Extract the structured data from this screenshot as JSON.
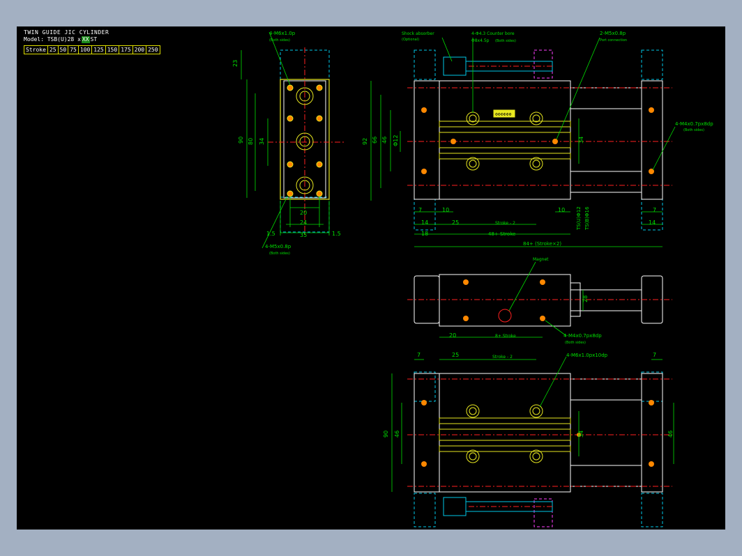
{
  "colors": {
    "background": "#000000",
    "outline": "#ffffff",
    "body": "#e8e820",
    "hidden": "#00c8e8",
    "dimension": "#00e000",
    "center": "#ff2020",
    "hole": "#ff8800",
    "option": "#ff40ff"
  },
  "title": {
    "name": "TWIN GUIDE JIC CYLINDER",
    "model_prefix": "Model: TSB(U)28 x",
    "model_size": "XX",
    "model_suffix": "ST"
  },
  "stroke_table": {
    "label": "Stroke",
    "values": [
      "25",
      "50",
      "75",
      "100",
      "125",
      "150",
      "175",
      "200",
      "250"
    ]
  },
  "callouts": {
    "side_top": "4-M6x1.0p",
    "both_sides": "(Both sides)",
    "side_bottom": "4-M5x0.8p",
    "shock_absorber": "Shock absorber",
    "optional": "(Optional)",
    "counter_bore": "4-Φ4.3 Counter bore",
    "counter_bore_sub": "Φ8x4.5p",
    "port": "2-M5x0.8p",
    "port_sub": "Port connection",
    "right_tap": "4-M4x0.7px8dp",
    "magnet": "Magnet",
    "mid_tap": "4-M4x0.7px8dp",
    "bottom_tap": "4-M6x1.0px10dp",
    "plate_label": "ΦΦΦΦΦΦ"
  },
  "dims": {
    "d23": "23",
    "d90": "90",
    "d80": "80",
    "d34": "34",
    "d20": "20",
    "d24": "24",
    "d35": "35",
    "d1_5": "1.5",
    "d92": "92",
    "d66": "66",
    "d46": "46",
    "d12": "Φ12",
    "d34b": "34",
    "d7": "7",
    "d10": "10",
    "d14": "14",
    "d25": "25",
    "stroke_minus_2": "Stroke - 2",
    "d18": "18",
    "d48": "48+ Stroke",
    "d84": "84+ (Stroke×2)",
    "ts_u": "TS(U)Φ12",
    "ts_b": "TS(B)Φ16",
    "d28": "28",
    "d20b": "20",
    "d8": "8+ Stroke",
    "d7b": "7",
    "d25b": "25",
    "stroke_minus_2b": "Stroke - 2",
    "d7c": "7",
    "d90b": "90",
    "d46b": "46",
    "d34c": "34",
    "d46c": "46"
  }
}
